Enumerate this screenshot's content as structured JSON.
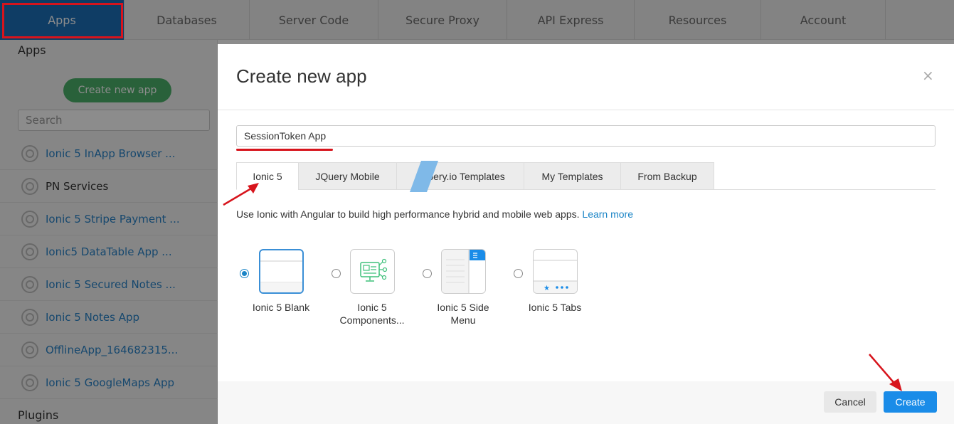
{
  "topnav": {
    "tabs": [
      {
        "label": "Apps",
        "active": true
      },
      {
        "label": "Databases"
      },
      {
        "label": "Server Code"
      },
      {
        "label": "Secure Proxy"
      },
      {
        "label": "API Express"
      },
      {
        "label": "Resources"
      },
      {
        "label": "Account"
      }
    ]
  },
  "sidebar": {
    "apps_heading": "Apps",
    "create_button": "Create new app",
    "search_placeholder": "Search",
    "items": [
      {
        "label": "Ionic 5 InApp Browser ..."
      },
      {
        "label": "PN Services"
      },
      {
        "label": "Ionic 5 Stripe Payment ..."
      },
      {
        "label": "Ionic5 DataTable App ..."
      },
      {
        "label": "Ionic 5 Secured Notes ..."
      },
      {
        "label": "Ionic 5 Notes App"
      },
      {
        "label": "OfflineApp_164682315..."
      },
      {
        "label": "Ionic 5 GoogleMaps App"
      }
    ],
    "plugins_heading": "Plugins"
  },
  "modal": {
    "title": "Create new app",
    "close_glyph": "×",
    "app_name_value": "SessionToken App",
    "tabs": [
      {
        "label": "Ionic 5",
        "active": true
      },
      {
        "label": "JQuery Mobile"
      },
      {
        "label": "Appery.io Templates"
      },
      {
        "label": "My Templates"
      },
      {
        "label": "From Backup"
      }
    ],
    "description": "Use Ionic with Angular to build high performance hybrid and mobile web apps.",
    "learn_more": "Learn more",
    "templates": [
      {
        "label": "Ionic 5 Blank",
        "selected": true,
        "icon": "blank-template-icon"
      },
      {
        "label": "Ionic 5 Components...",
        "selected": false,
        "icon": "components-template-icon"
      },
      {
        "label": "Ionic 5 Side Menu",
        "selected": false,
        "icon": "side-menu-template-icon"
      },
      {
        "label": "Ionic 5 Tabs",
        "selected": false,
        "icon": "tabs-template-icon"
      }
    ],
    "cancel_label": "Cancel",
    "create_label": "Create"
  },
  "colors": {
    "accent": "#1a8ce8",
    "annotation": "#d7141c",
    "create_app_green": "#4cb16a"
  }
}
